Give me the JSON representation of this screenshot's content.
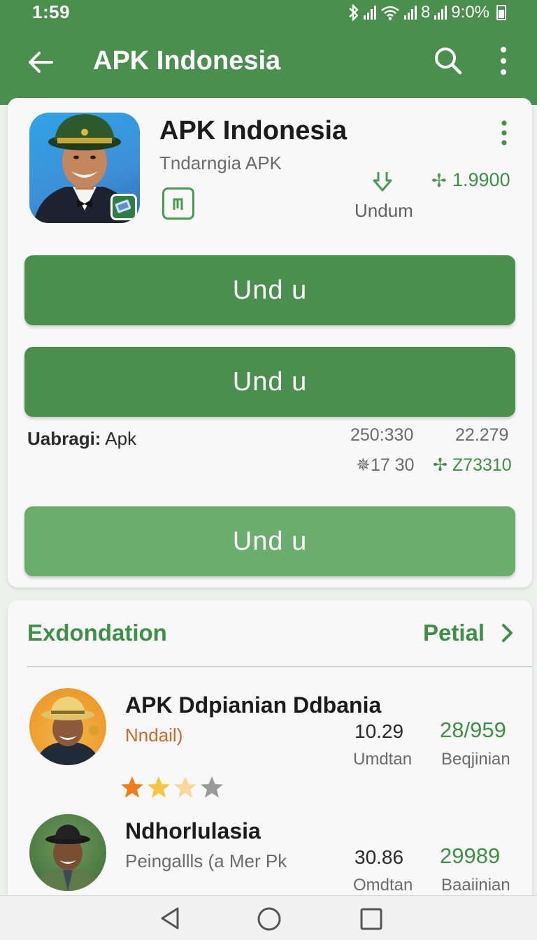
{
  "status_bar": {
    "time": "1:59",
    "bluetooth_icon": "bluetooth-icon",
    "wifi_icon": "wifi-icon",
    "sim_label": "8",
    "battery": "9:0%"
  },
  "appbar": {
    "title": "APK Indonesia",
    "back_icon": "arrow-left-icon",
    "search_icon": "search-icon",
    "menu_icon": "more-vert-icon"
  },
  "app": {
    "title": "APK Indonesia",
    "subtitle": "Tndarngia APK",
    "verify_label": "⨅",
    "download_label": "Undum",
    "rating_mark": "✢",
    "rating_value": "1.9900"
  },
  "buttons": {
    "primary_1": "Und u",
    "primary_2": "Und u",
    "primary_3": "Und u"
  },
  "stats": {
    "category_label": "Uabragi:",
    "category_value": "Apk",
    "a": "250:330",
    "b": "22.279",
    "c": "✵17 30",
    "d": "✢ Z73310"
  },
  "recommendations": {
    "title": "Exdondation",
    "link_label": "Petial",
    "items": [
      {
        "title": "APK Ddpianian Ddbania",
        "subtitle": "Nndail)",
        "size": "10.29",
        "size_label": "Umdtan",
        "count": "28/959",
        "count_label": "Beqjinian",
        "rating": 2.5,
        "max_rating": 5
      },
      {
        "title": "Ndhorlulasia",
        "subtitle": "Peingallls (a Mer Pk",
        "size": "30.86",
        "size_label": "Omdtan",
        "count": "29989",
        "count_label": "Baaiinian"
      }
    ]
  },
  "colors": {
    "brand_green": "#4a8f4e",
    "accent_green": "#3f8f46",
    "light_green": "#6aad6c",
    "subtitle_orange": "#d2652c",
    "star_orange": "#f07d1a",
    "star_yellow": "#f5c542"
  }
}
